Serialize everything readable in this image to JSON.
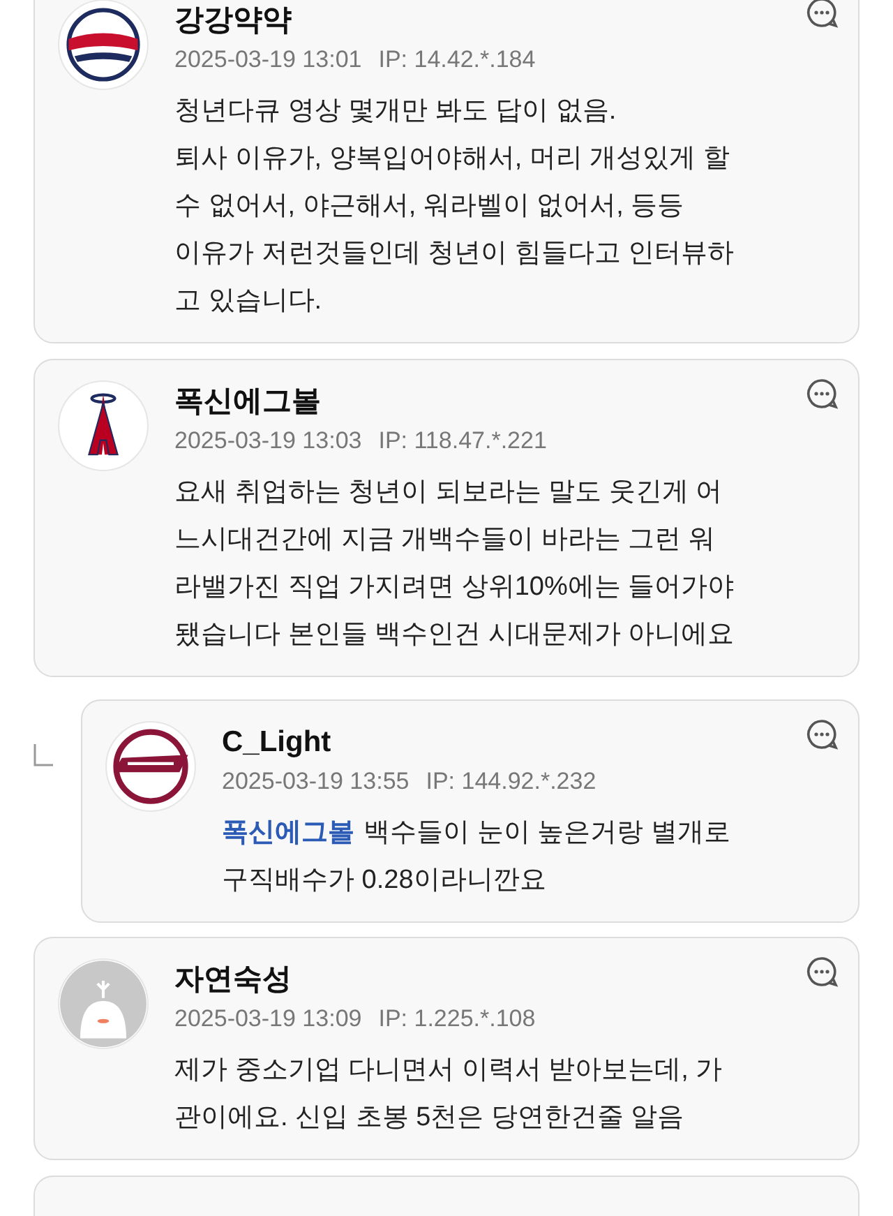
{
  "comments": [
    {
      "kind": "giants",
      "author": "강강약약",
      "date": "2025-03-19 13:01",
      "ip": "IP: 14.42.*.184",
      "reply": false,
      "lines": [
        "청년다큐 영상 몇개만 봐도 답이 없음.",
        "퇴사 이유가, 양복입어야해서, 머리 개성있게 할",
        "수 없어서, 야근해서, 워라벨이 없어서, 등등",
        "이유가 저런것들인데 청년이 힘들다고 인터뷰하",
        "고 있습니다."
      ]
    },
    {
      "kind": "angels",
      "author": "폭신에그볼",
      "date": "2025-03-19 13:03",
      "ip": "IP: 118.47.*.221",
      "reply": false,
      "lines": [
        "요새 취업하는 청년이 되보라는 말도 웃긴게 어",
        "느시대건간에 지금 개백수들이 바라는 그런 워",
        "라밸가진 직업 가지려면 상위10%에는 들어가야",
        "됐습니다 본인들 백수인건 시대문제가 아니에요"
      ]
    },
    {
      "kind": "kiwoom",
      "author": "C_Light",
      "date": "2025-03-19 13:55",
      "ip": "IP: 144.92.*.232",
      "reply": true,
      "mention": "폭신에그볼",
      "lines": [
        "백수들이 눈이 높은거랑 별개로",
        "구직배수가 0.28이라니깐요"
      ]
    },
    {
      "kind": "default",
      "author": "자연숙성",
      "date": "2025-03-19 13:09",
      "ip": "IP: 1.225.*.108",
      "reply": false,
      "lines": [
        "제가 중소기업 다니면서 이력서 받아보는데, 가",
        "관이에요. 신입 초봉 5천은 당연한건줄 알음"
      ]
    }
  ]
}
